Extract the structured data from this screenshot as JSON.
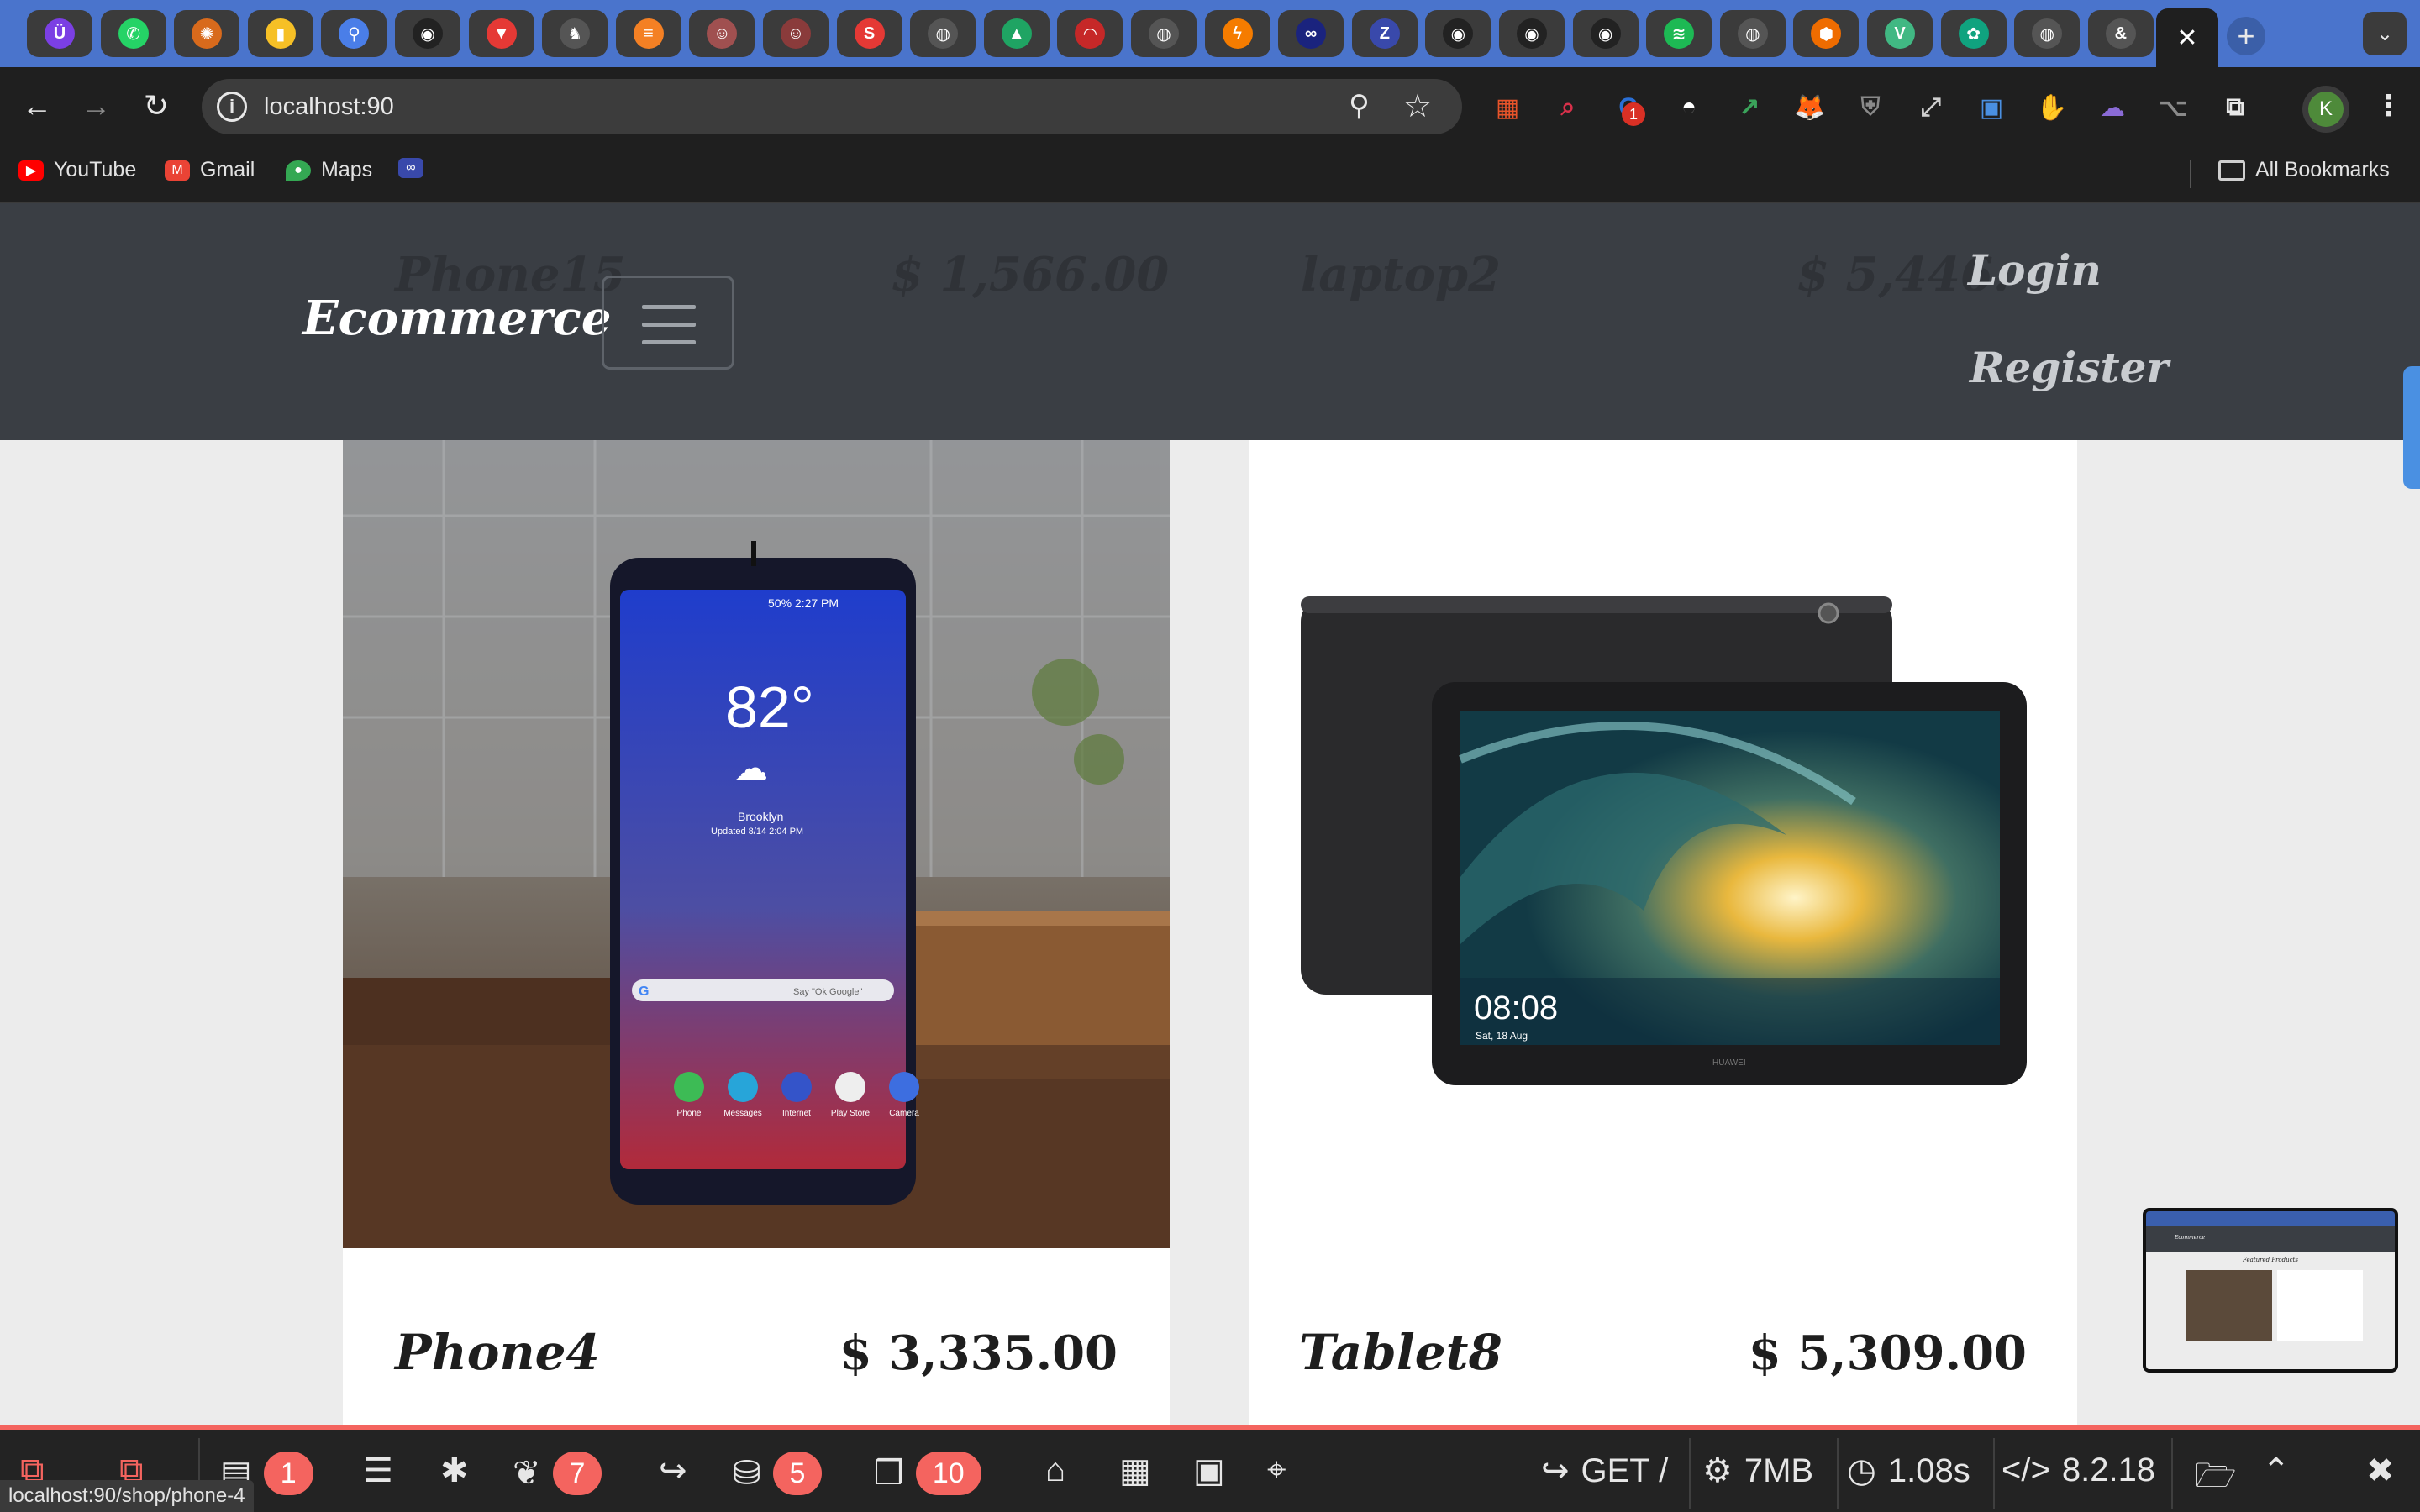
{
  "browser": {
    "tabs": [
      {
        "icon": "ublock-icon",
        "color": "#7b3fe4",
        "glyph": "Ü"
      },
      {
        "icon": "whatsapp-icon",
        "color": "#25d366",
        "glyph": "✆"
      },
      {
        "icon": "sunburst-icon",
        "color": "#d86a1c",
        "glyph": "✺"
      },
      {
        "icon": "keep-icon",
        "color": "#f6c026",
        "glyph": "▮"
      },
      {
        "icon": "docs-icon",
        "color": "#4a7ee8",
        "glyph": "⚲"
      },
      {
        "icon": "github-icon",
        "color": "#222222",
        "glyph": "◉"
      },
      {
        "icon": "vectr-icon",
        "color": "#e53935",
        "glyph": "▼"
      },
      {
        "icon": "elephant-icon",
        "color": "#555555",
        "glyph": "♞"
      },
      {
        "icon": "stackoverflow-icon",
        "color": "#f48024",
        "glyph": "≡"
      },
      {
        "icon": "profile-photo-icon",
        "color": "#a05050",
        "glyph": "☺"
      },
      {
        "icon": "profile-photo-icon",
        "color": "#8a3b3b",
        "glyph": "☺"
      },
      {
        "icon": "s-red-icon",
        "color": "#e53935",
        "glyph": "S"
      },
      {
        "icon": "globe-icon",
        "color": "#555555",
        "glyph": "◍"
      },
      {
        "icon": "drive-icon",
        "color": "#1fa463",
        "glyph": "▲"
      },
      {
        "icon": "gauge-icon",
        "color": "#c62828",
        "glyph": "◠"
      },
      {
        "icon": "globe-icon",
        "color": "#555555",
        "glyph": "◍"
      },
      {
        "icon": "bolt-icon",
        "color": "#f57c00",
        "glyph": "ϟ"
      },
      {
        "icon": "link-icon",
        "color": "#1a237e",
        "glyph": "∞"
      },
      {
        "icon": "zotero-icon",
        "color": "#3949ab",
        "glyph": "Z"
      },
      {
        "icon": "github-icon",
        "color": "#222222",
        "glyph": "◉"
      },
      {
        "icon": "github-icon",
        "color": "#222222",
        "glyph": "◉"
      },
      {
        "icon": "github-icon",
        "color": "#222222",
        "glyph": "◉"
      },
      {
        "icon": "spotify-icon",
        "color": "#1db954",
        "glyph": "≋"
      },
      {
        "icon": "globe-icon",
        "color": "#555555",
        "glyph": "◍"
      },
      {
        "icon": "box-icon",
        "color": "#ef6c00",
        "glyph": "⬢"
      },
      {
        "icon": "vue-icon",
        "color": "#41b883",
        "glyph": "V"
      },
      {
        "icon": "openai-icon",
        "color": "#10a37f",
        "glyph": "✿"
      },
      {
        "icon": "globe-icon",
        "color": "#555555",
        "glyph": "◍"
      },
      {
        "icon": "ampersand-icon",
        "color": "#555555",
        "glyph": "&"
      }
    ],
    "url": "localhost:90",
    "bookmarks": [
      {
        "label": "YouTube",
        "icon": "youtube-icon",
        "color": "#ff0000"
      },
      {
        "label": "Gmail",
        "icon": "gmail-icon",
        "color": "#ea4335"
      },
      {
        "label": "Maps",
        "icon": "maps-pin-icon",
        "color": "#34a853"
      },
      {
        "label": "",
        "icon": "link-icon",
        "color": "#3949ab"
      }
    ],
    "all_bookmarks": "All Bookmarks",
    "extension_badge": "1",
    "profile_initial": "K",
    "status_url": "localhost:90/shop/phone-4"
  },
  "site": {
    "brand": "Ecommerce",
    "nav": {
      "login": "Login",
      "register": "Register"
    },
    "ghost_row": {
      "p1": "Phone15",
      "price1": "$ 1,566.00",
      "p2": "laptop2",
      "price2": "$ 5,446."
    },
    "products": [
      {
        "name": "Phone4",
        "price": "$ 3,335.00"
      },
      {
        "name": "Tablet8",
        "price": "$ 5,309.00"
      }
    ],
    "phone_screen": {
      "temp": "82°",
      "city": "Brooklyn",
      "updated": "Updated 8/14 2:04 PM",
      "statusbar": "50% 2:27 PM",
      "search_hint": "Say \"Ok Google\"",
      "apps": [
        "Phone",
        "Messages",
        "Internet",
        "Play Store",
        "Camera"
      ]
    },
    "tablet_screen": {
      "time": "08:08",
      "date": "Sat, 18 Aug",
      "brand": "HUAWEI"
    },
    "thumbnail": {
      "brand": "Ecommerce",
      "heading": "Featured Products"
    }
  },
  "debugbar": {
    "messages": "1",
    "models": "7",
    "queries": "5",
    "views": "10",
    "method": "GET /",
    "memory": "7MB",
    "time": "1.08s",
    "php": "8.2.18"
  }
}
